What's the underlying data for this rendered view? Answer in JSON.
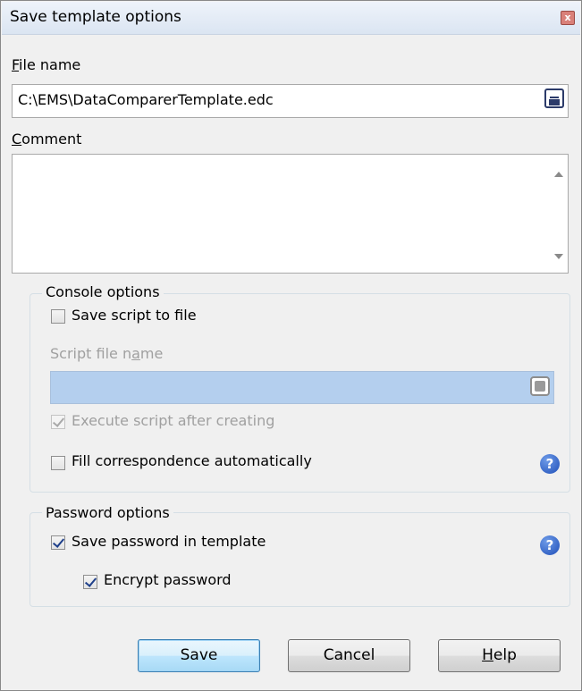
{
  "dialog": {
    "title": "Save template options",
    "close_glyph": "x"
  },
  "file_name": {
    "label_accel": "F",
    "label_rest": "ile name",
    "value": "C:\\EMS\\DataComparerTemplate.edc",
    "browse_icon": "save-disk-icon"
  },
  "comment": {
    "label_accel": "C",
    "label_rest": "omment",
    "value": ""
  },
  "console_options": {
    "title": "Console options",
    "save_script": {
      "label": "Save script to file",
      "checked": false
    },
    "script_file": {
      "label_pre": "Script file n",
      "label_accel": "a",
      "label_post": "me",
      "value": "",
      "disabled": true
    },
    "execute_script": {
      "label": "Execute script after creating",
      "checked": true,
      "disabled": true
    },
    "fill_correspondence": {
      "label": "Fill correspondence automatically",
      "checked": false
    },
    "help_glyph": "?"
  },
  "password_options": {
    "title": "Password options",
    "save_password": {
      "label": "Save password in template",
      "checked": true
    },
    "encrypt_password": {
      "label": "Encrypt password",
      "checked": true
    },
    "help_glyph": "?"
  },
  "buttons": {
    "save": "Save",
    "cancel": "Cancel",
    "help_accel": "H",
    "help_rest": "elp"
  },
  "colors": {
    "script_field_bg": "#b4cfee",
    "help_icon": "#1f4fb8"
  }
}
